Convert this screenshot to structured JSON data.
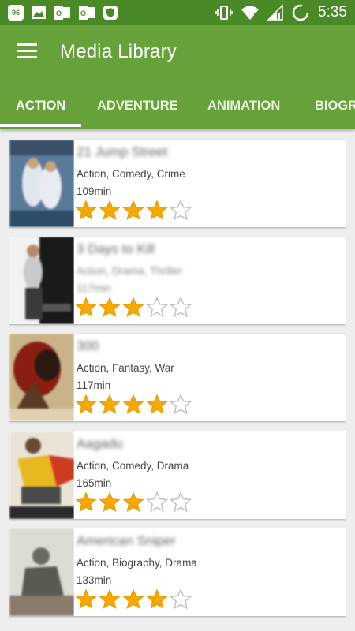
{
  "status_bar": {
    "time": "5:35",
    "notif_badge": "96",
    "icons": [
      "notification-96-icon",
      "image-icon",
      "outlook-icon",
      "outlook-icon",
      "shield-icon",
      "vibrate-icon",
      "wifi-icon",
      "signal-icon",
      "battery-loading-icon"
    ]
  },
  "toolbar": {
    "title": "Media Library"
  },
  "tabs": [
    {
      "label": "ACTION",
      "active": true
    },
    {
      "label": "ADVENTURE",
      "active": false
    },
    {
      "label": "ANIMATION",
      "active": false
    },
    {
      "label": "BIOGR",
      "active": false
    }
  ],
  "movies": [
    {
      "title": "21 Jump Street",
      "genres": "Action, Comedy, Crime",
      "duration": "109min",
      "rating": 4,
      "max_rating": 5
    },
    {
      "title": "3 Days to Kill",
      "genres": "Action, Drama, Thriller",
      "duration": "117min",
      "rating": 3,
      "max_rating": 5
    },
    {
      "title": "300",
      "genres": "Action, Fantasy, War",
      "duration": "117min",
      "rating": 4,
      "max_rating": 5
    },
    {
      "title": "Aagadu",
      "genres": "Action, Comedy, Drama",
      "duration": "165min",
      "rating": 3,
      "max_rating": 5
    },
    {
      "title": "American Sniper",
      "genres": "Action, Biography, Drama",
      "duration": "133min",
      "rating": 4,
      "max_rating": 5
    }
  ],
  "colors": {
    "status_bar": "#4a8a26",
    "primary": "#67a13a",
    "star_filled": "#f5a800",
    "star_empty": "#bdbdbd",
    "background": "#eeeeee"
  }
}
